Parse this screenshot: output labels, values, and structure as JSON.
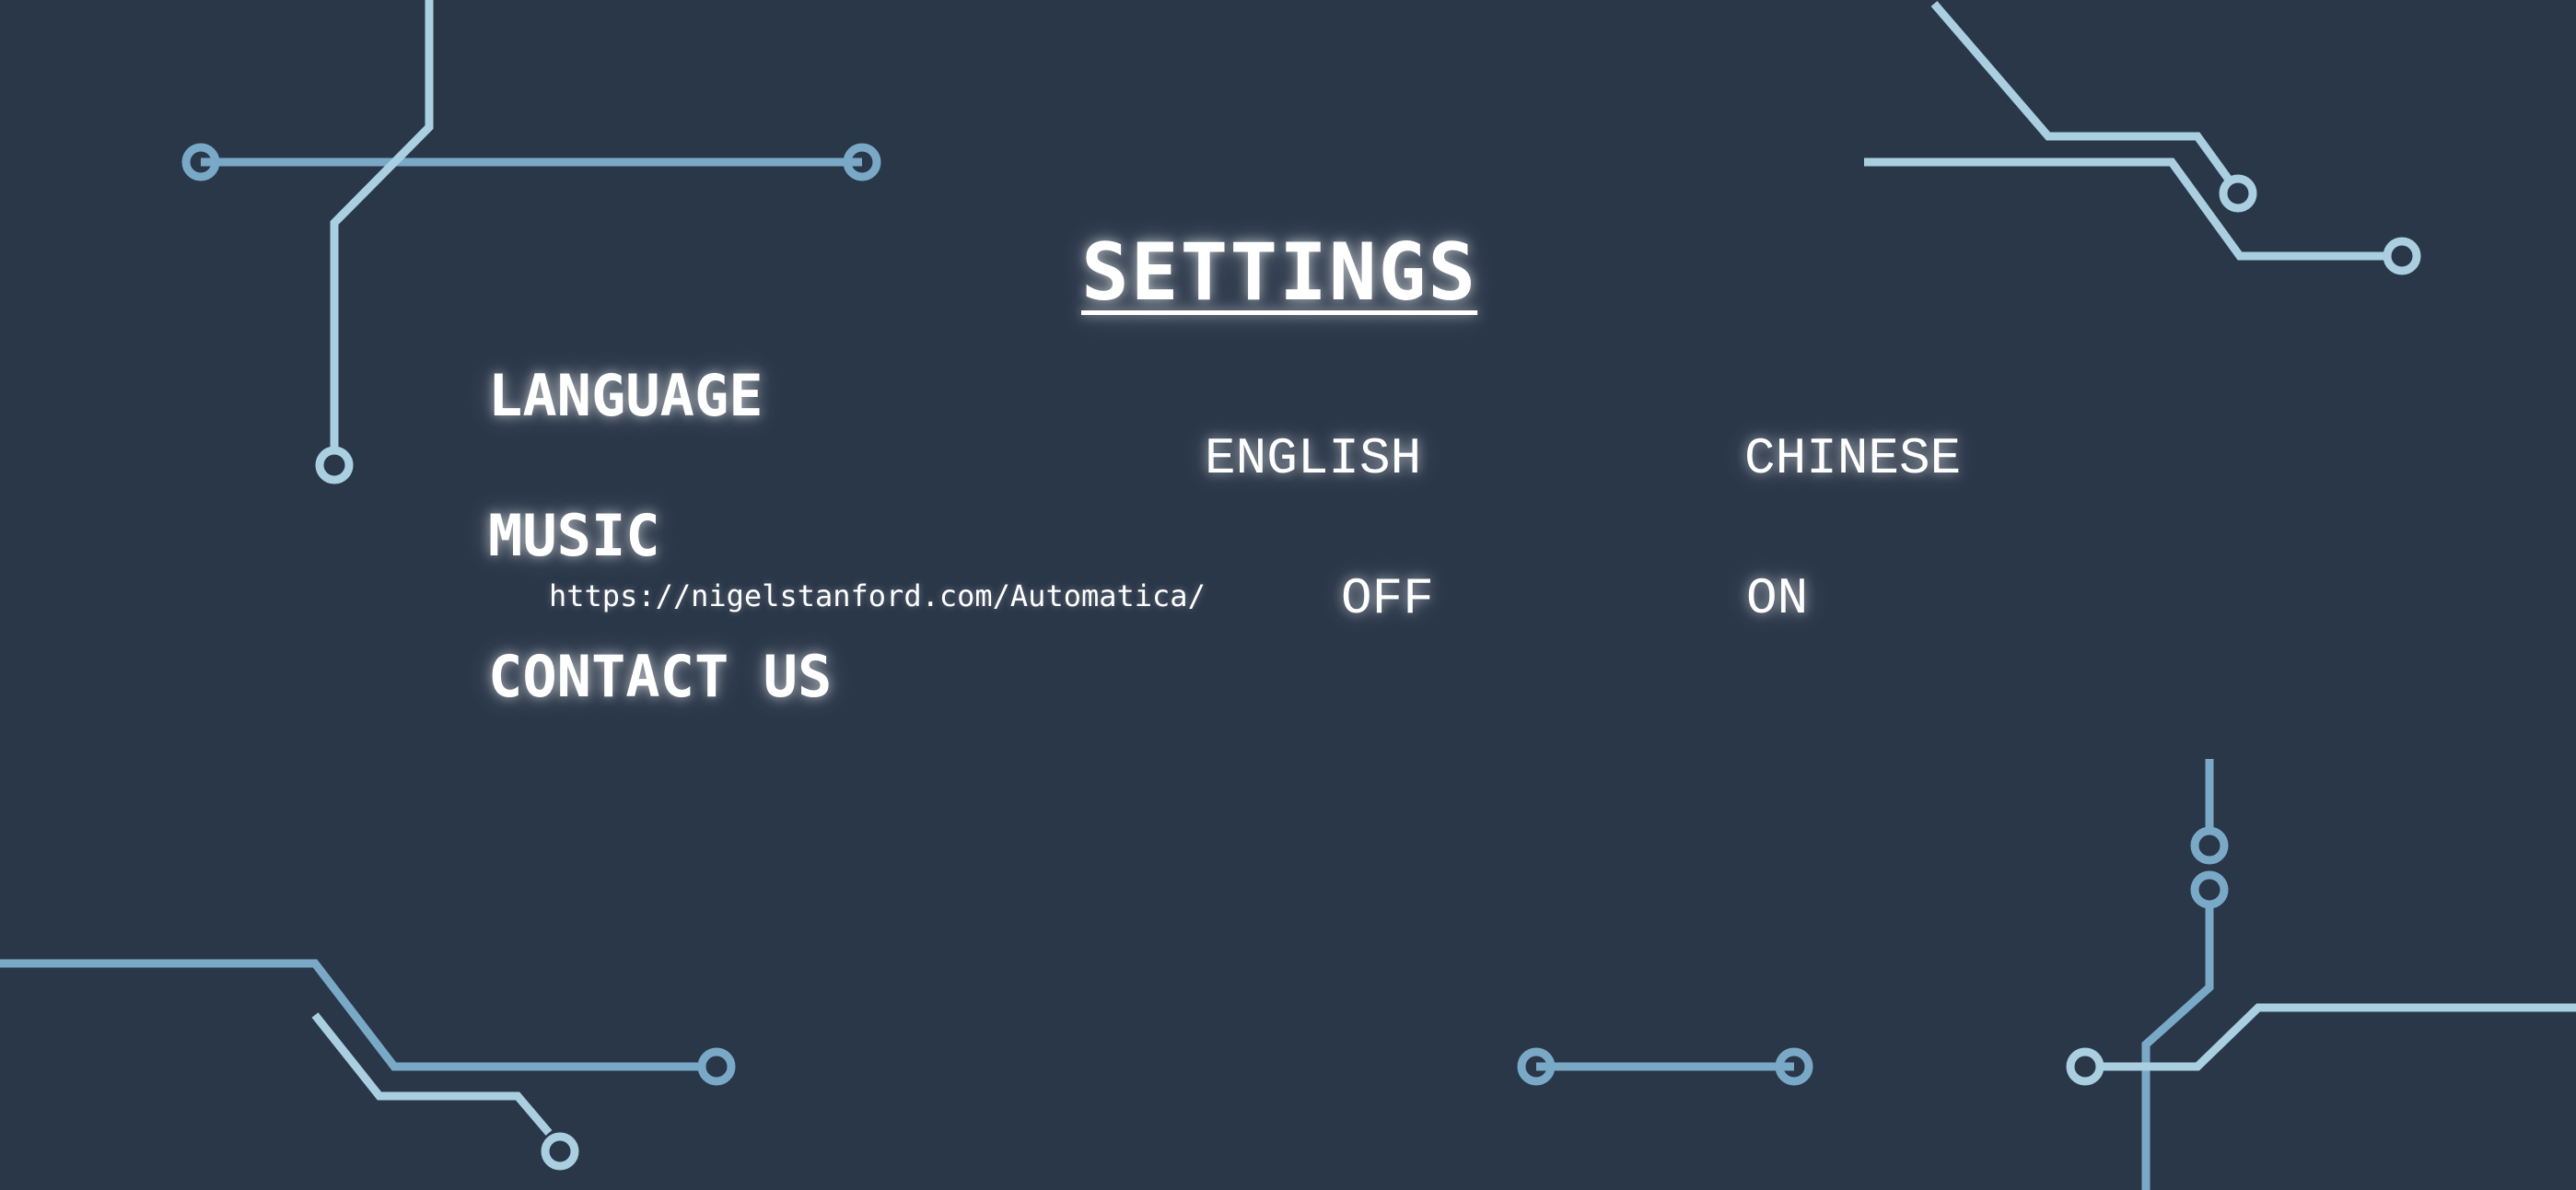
{
  "title": "SETTINGS",
  "sections": {
    "language": {
      "label": "LANGUAGE",
      "options": [
        "ENGLISH",
        "CHINESE"
      ]
    },
    "music": {
      "label": "MUSIC",
      "credit_link": "https://nigelstanford.com/Automatica/",
      "options": [
        "OFF",
        "ON"
      ]
    },
    "contact": {
      "label": "CONTACT US"
    }
  },
  "colors": {
    "background": "#2a3749",
    "trace_light": "#a9cfe0",
    "trace_mid": "#79a9c6",
    "text": "#ffffff"
  }
}
